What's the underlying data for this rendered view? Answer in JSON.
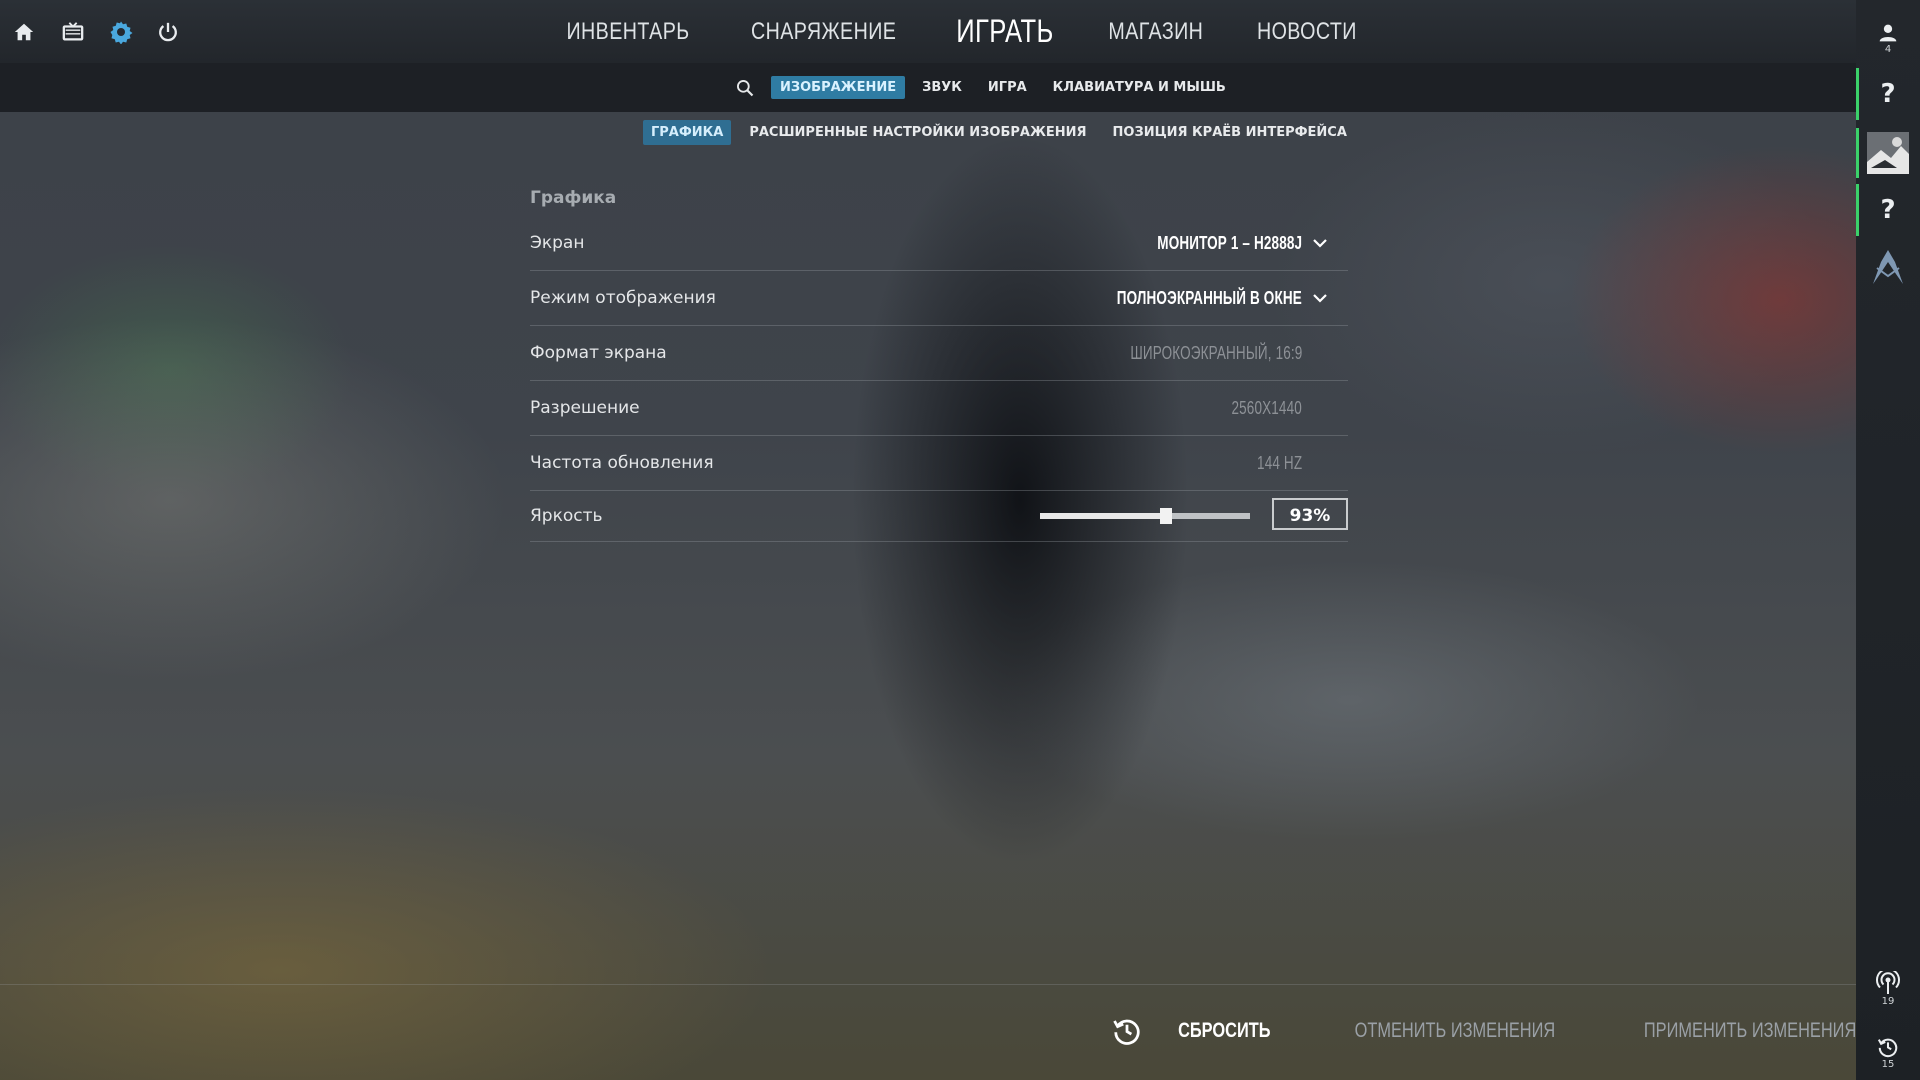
{
  "top_nav": {
    "items": [
      {
        "label": "ИНВЕНТАРЬ"
      },
      {
        "label": "СНАРЯЖЕНИЕ"
      },
      {
        "label": "ИГРАТЬ"
      },
      {
        "label": "МАГАЗИН"
      },
      {
        "label": "НОВОСТИ"
      }
    ],
    "left_icons": [
      "home-icon",
      "tv-icon",
      "gear-icon",
      "power-icon"
    ]
  },
  "settings_tabs": {
    "items": [
      {
        "label": "ИЗОБРАЖЕНИЕ",
        "active": true
      },
      {
        "label": "ЗВУК"
      },
      {
        "label": "ИГРА"
      },
      {
        "label": "КЛАВИАТУРА И МЫШЬ"
      }
    ]
  },
  "sub_tabs": {
    "items": [
      {
        "label": "ГРАФИКА",
        "active": true
      },
      {
        "label": "РАСШИРЕННЫЕ НАСТРОЙКИ ИЗОБРАЖЕНИЯ"
      },
      {
        "label": "ПОЗИЦИЯ КРАЁВ ИНТЕРФЕЙСА"
      }
    ]
  },
  "graphics": {
    "section_title": "Графика",
    "rows": [
      {
        "label": "Экран",
        "value": "МОНИТОР 1 – H2888J"
      },
      {
        "label": "Режим отображения",
        "value": "ПОЛНОЭКРАННЫЙ В ОКНЕ"
      },
      {
        "label": "Формат экрана",
        "value": "ШИРОКОЭКРАННЫЙ, 16:9"
      },
      {
        "label": "Разрешение",
        "value": "2560X1440"
      },
      {
        "label": "Частота обновления",
        "value": "144 HZ"
      }
    ],
    "brightness": {
      "label": "Яркость",
      "value_text": "93%",
      "slider_fraction": 0.6
    }
  },
  "bottom_bar": {
    "reset": "СБРОСИТЬ",
    "cancel": "ОТМЕНИТЬ ИЗМЕНЕНИЯ",
    "apply": "ПРИМЕНИТЬ ИЗМЕНЕНИЯ"
  },
  "right_rail": {
    "friends_count": "4",
    "question_mark": "?",
    "broadcast_count": "19",
    "history_count": "15"
  },
  "colors": {
    "accent_tab": "#2f7ca3",
    "online_green": "#3bd16a"
  }
}
